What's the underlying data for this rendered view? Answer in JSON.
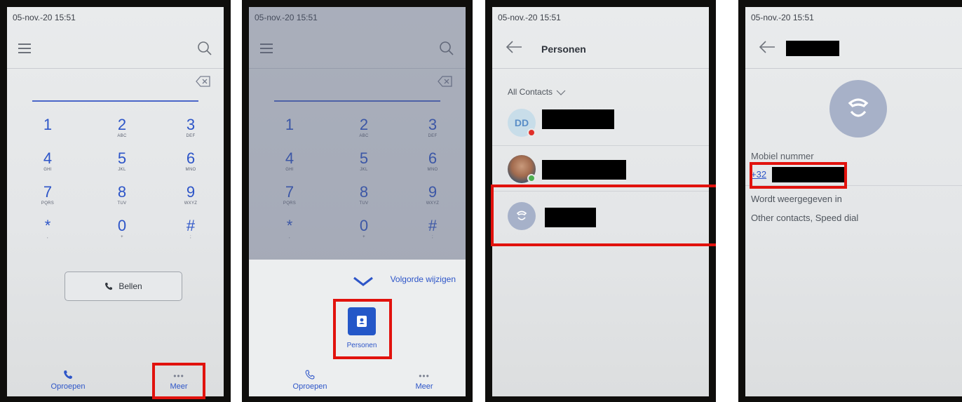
{
  "status_time": "05-nov.-20 15:51",
  "colors": {
    "accent": "#2d55c8",
    "highlight": "#e1120d",
    "avatar_initials_bg": "#c8dde9"
  },
  "dialer": {
    "keys": [
      {
        "digit": "1",
        "letters": ""
      },
      {
        "digit": "2",
        "letters": "ABC"
      },
      {
        "digit": "3",
        "letters": "DEF"
      },
      {
        "digit": "4",
        "letters": "GHI"
      },
      {
        "digit": "5",
        "letters": "JKL"
      },
      {
        "digit": "6",
        "letters": "MNO"
      },
      {
        "digit": "7",
        "letters": "PQRS"
      },
      {
        "digit": "8",
        "letters": "TUV"
      },
      {
        "digit": "9",
        "letters": "WXYZ"
      },
      {
        "digit": "*",
        "letters": ","
      },
      {
        "digit": "0",
        "letters": "+"
      },
      {
        "digit": "#",
        "letters": ";"
      }
    ],
    "call_label": "Bellen"
  },
  "bottom_nav": {
    "calls": "Oproepen",
    "more": "Meer"
  },
  "more_sheet": {
    "reorder_label": "Volgorde wijzigen",
    "people_label": "Personen"
  },
  "people": {
    "title": "Personen",
    "filter": "All Contacts",
    "contacts": [
      {
        "initials": "DD",
        "presence": "busy",
        "presence_color": "#e0302a"
      },
      {
        "initials": "",
        "presence": "available",
        "presence_color": "#4caf50"
      },
      {
        "initials": "",
        "presence": "none"
      }
    ]
  },
  "contact_detail": {
    "field_label": "Mobiel nummer",
    "number_prefix": "+32",
    "shown_in_label": "Wordt weergegeven in",
    "shown_in_value": "Other contacts, Speed dial"
  }
}
